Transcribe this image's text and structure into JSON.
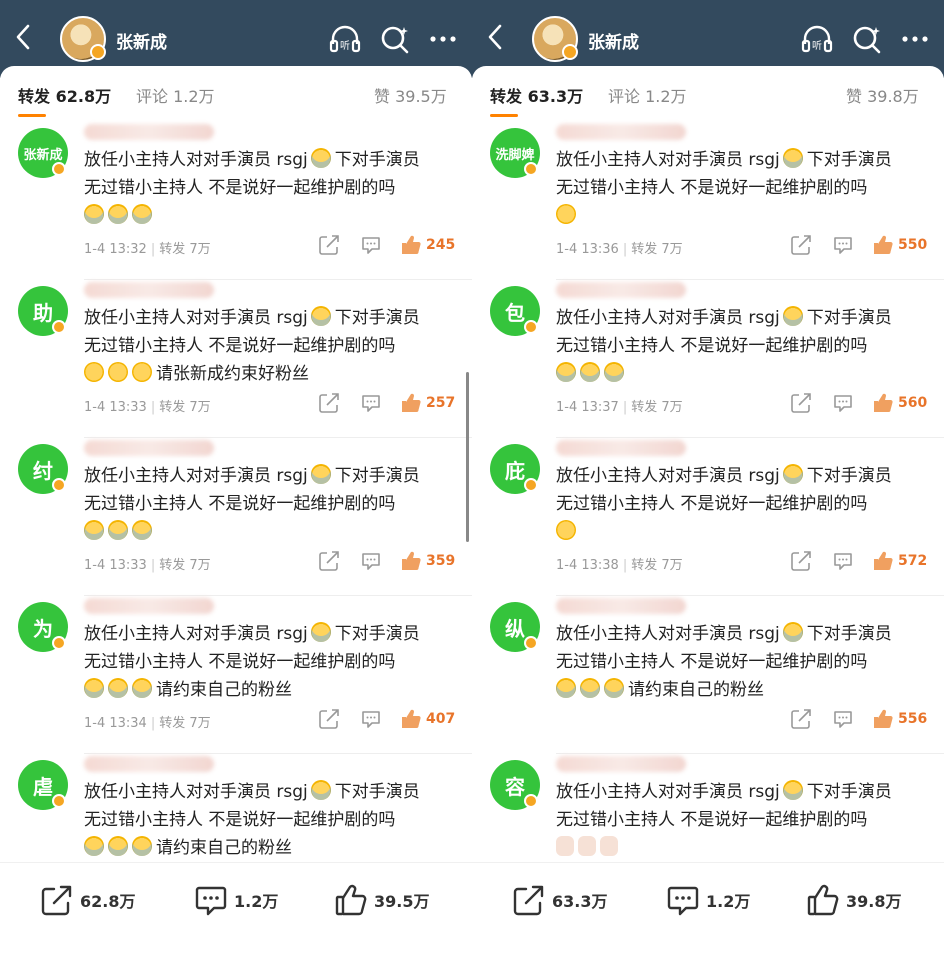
{
  "panels": [
    {
      "user": {
        "name": "张新成"
      },
      "tabs": {
        "repost": {
          "label": "转发",
          "count": "62.8万"
        },
        "comment": {
          "label": "评论",
          "count": "1.2万"
        },
        "like": {
          "label": "赞",
          "count": "39.5万"
        }
      },
      "items": [
        {
          "avatar_text": "张新成",
          "text": "放任小主持人对对手演员 rsgj",
          "text2": "下对手演员",
          "line2": "无过错小主持人 不是说好一起维护剧的吗",
          "line3": "",
          "line3_emojis": [
            "cry",
            "cry",
            "cry"
          ],
          "time": "1-4 13:32",
          "repost": "转发 7万",
          "likes": "245"
        },
        {
          "avatar_text": "助",
          "text": "放任小主持人对对手演员 rsgj",
          "text2": "下对手演员",
          "line2": "无过错小主持人 不是说好一起维护剧的吗",
          "line3": "请张新成约束好粉丝",
          "line3_emojis": [
            "sad",
            "sad",
            "sad"
          ],
          "time": "1-4 13:33",
          "repost": "转发 7万",
          "likes": "257"
        },
        {
          "avatar_text": "纣",
          "text": "放任小主持人对对手演员 rsgj",
          "text2": "下对手演员",
          "line2": "无过错小主持人 不是说好一起维护剧的吗",
          "line3": "",
          "line3_emojis": [
            "cry",
            "cry",
            "cry"
          ],
          "time": "1-4 13:33",
          "repost": "转发 7万",
          "likes": "359"
        },
        {
          "avatar_text": "为",
          "text": "放任小主持人对对手演员 rsgj",
          "text2": "下对手演员",
          "line2": "无过错小主持人 不是说好一起维护剧的吗",
          "line3": "请约束自己的粉丝",
          "line3_emojis": [
            "cry",
            "cry",
            "cry"
          ],
          "time": "1-4 13:34",
          "repost": "转发 7万",
          "likes": "407"
        },
        {
          "avatar_text": "虐",
          "text": "放任小主持人对对手演员 rsgj",
          "text2": "下对手演员",
          "line2": "无过错小主持人 不是说好一起维护剧的吗",
          "line3": "请约束自己的粉丝",
          "line3_emojis": [
            "cry",
            "cry",
            "cry"
          ],
          "time": "",
          "repost": "",
          "likes": ""
        }
      ],
      "bottom": {
        "repost": "62.8万",
        "comment": "1.2万",
        "like": "39.5万"
      }
    },
    {
      "user": {
        "name": "张新成"
      },
      "tabs": {
        "repost": {
          "label": "转发",
          "count": "63.3万"
        },
        "comment": {
          "label": "评论",
          "count": "1.2万"
        },
        "like": {
          "label": "赞",
          "count": "39.8万"
        }
      },
      "items": [
        {
          "avatar_text": "洗脚婢",
          "text": "放任小主持人对对手演员 rsgj",
          "text2": "下对手演员",
          "line2": "无过错小主持人 不是说好一起维护剧的吗",
          "line3": "",
          "line3_emojis": [
            "sad"
          ],
          "time": "1-4 13:36",
          "repost": "转发 7万",
          "likes": "550"
        },
        {
          "avatar_text": "包",
          "text": "放任小主持人对对手演员 rsgj",
          "text2": "下对手演员",
          "line2": "无过错小主持人 不是说好一起维护剧的吗",
          "line3": "",
          "line3_emojis": [
            "cry",
            "cry",
            "cry"
          ],
          "time": "1-4 13:37",
          "repost": "转发 7万",
          "likes": "560"
        },
        {
          "avatar_text": "庇",
          "text": "放任小主持人对对手演员 rsgj",
          "text2": "下对手演员",
          "line2": "无过错小主持人 不是说好一起维护剧的吗",
          "line3": "",
          "line3_emojis": [
            "sad"
          ],
          "time": "1-4 13:38",
          "repost": "转发 7万",
          "likes": "572"
        },
        {
          "avatar_text": "纵",
          "text": "放任小主持人对对手演员 rsgj",
          "text2": "下对手演员",
          "line2": "无过错小主持人 不是说好一起维护剧的吗",
          "line3": "请约束自己的粉丝",
          "line3_emojis": [
            "cry",
            "cry",
            "cry"
          ],
          "time": "",
          "repost": "",
          "likes": "556"
        },
        {
          "avatar_text": "容",
          "text": "放任小主持人对对手演员 rsgj",
          "text2": "下对手演员",
          "line2": "无过错小主持人 不是说好一起维护剧的吗",
          "line3": "",
          "line3_emojis": [
            "clap",
            "clap",
            "clap"
          ],
          "time": "",
          "repost": "",
          "likes": ""
        }
      ],
      "bottom": {
        "repost": "63.3万",
        "comment": "1.2万",
        "like": "39.8万"
      }
    }
  ],
  "colors": {
    "header": "#334a5e",
    "avatar": "#35c43c",
    "accent": "#ff8200",
    "likes": "#e8742a"
  }
}
